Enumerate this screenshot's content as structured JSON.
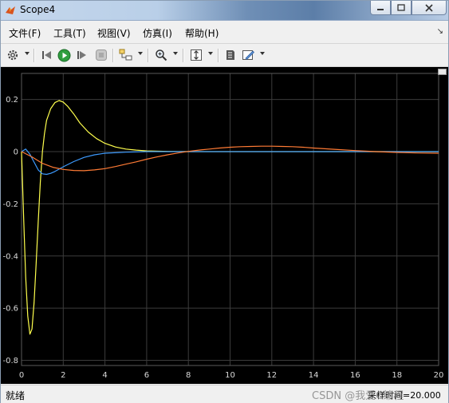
{
  "window": {
    "title": "Scope4"
  },
  "menu": {
    "items": [
      "文件(F)",
      "工具(T)",
      "视图(V)",
      "仿真(I)",
      "帮助(H)"
    ]
  },
  "toolbar": {
    "icons": [
      "gear-icon",
      "step-back-icon",
      "run-icon",
      "step-forward-icon",
      "stop-icon",
      "highlight-block-icon",
      "zoom-icon",
      "autoscale-icon",
      "print-icon",
      "style-icon"
    ]
  },
  "status": {
    "left": "就绪",
    "right": "采样时间=20.000",
    "watermark": "CSDN @我爱C编程"
  },
  "chart_data": {
    "type": "line",
    "xlim": [
      0,
      20
    ],
    "ylim": [
      -0.82,
      0.3
    ],
    "xticks": [
      0,
      2,
      4,
      6,
      8,
      10,
      12,
      14,
      16,
      18,
      20
    ],
    "yticks": [
      0.2,
      0,
      -0.2,
      -0.4,
      -0.6,
      -0.8
    ],
    "ytick_labels": [
      "0.2",
      "0",
      "-0.2",
      "-0.4",
      "-0.6",
      "-0.8"
    ],
    "grid": true,
    "colors": {
      "background": "#000000",
      "grid": "#3c3c3c",
      "axis_text": "#d9d9d9"
    },
    "series": [
      {
        "color": "#ffff4d",
        "x": [
          0,
          0.1,
          0.2,
          0.3,
          0.4,
          0.5,
          0.6,
          0.7,
          0.8,
          0.9,
          1.0,
          1.1,
          1.2,
          1.4,
          1.6,
          1.8,
          2.0,
          2.2,
          2.5,
          2.8,
          3.2,
          3.6,
          4.0,
          4.5,
          5.0,
          5.5,
          6.0,
          7.0,
          8.0,
          9.0,
          10,
          12,
          14,
          16,
          18,
          20
        ],
        "y": [
          0,
          -0.25,
          -0.48,
          -0.63,
          -0.7,
          -0.68,
          -0.58,
          -0.43,
          -0.27,
          -0.12,
          0.0,
          0.07,
          0.12,
          0.165,
          0.188,
          0.196,
          0.19,
          0.175,
          0.145,
          0.11,
          0.075,
          0.05,
          0.032,
          0.018,
          0.01,
          0.006,
          0.003,
          0.001,
          0,
          0,
          0,
          0,
          0,
          0,
          0,
          0
        ]
      },
      {
        "color": "#3d9bff",
        "x": [
          0,
          0.2,
          0.4,
          0.6,
          0.8,
          1.0,
          1.2,
          1.4,
          1.6,
          2.0,
          2.5,
          3.0,
          3.5,
          4.0,
          5.0,
          6.0,
          7.0,
          8.0,
          10,
          12,
          14,
          16,
          18,
          20
        ],
        "y": [
          0,
          0.01,
          -0.01,
          -0.04,
          -0.07,
          -0.085,
          -0.087,
          -0.083,
          -0.076,
          -0.058,
          -0.038,
          -0.022,
          -0.012,
          -0.006,
          -0.002,
          0,
          0,
          0,
          0,
          0,
          0,
          0,
          0,
          0
        ]
      },
      {
        "color": "#ff7b35",
        "x": [
          0,
          0.5,
          1.0,
          1.5,
          2.0,
          2.5,
          3.0,
          3.5,
          4.0,
          4.5,
          5.0,
          5.5,
          6.0,
          6.5,
          7.0,
          7.5,
          8.0,
          8.5,
          9.0,
          9.5,
          10,
          10.5,
          11,
          11.5,
          12,
          12.5,
          13,
          13.5,
          14,
          15,
          16,
          17,
          18,
          19,
          20
        ],
        "y": [
          0,
          -0.02,
          -0.045,
          -0.06,
          -0.068,
          -0.072,
          -0.073,
          -0.07,
          -0.065,
          -0.057,
          -0.048,
          -0.039,
          -0.029,
          -0.02,
          -0.012,
          -0.005,
          0.001,
          0.006,
          0.01,
          0.014,
          0.017,
          0.019,
          0.02,
          0.021,
          0.021,
          0.02,
          0.019,
          0.017,
          0.014,
          0.009,
          0.004,
          0.0,
          -0.003,
          -0.005,
          -0.006
        ]
      }
    ]
  }
}
